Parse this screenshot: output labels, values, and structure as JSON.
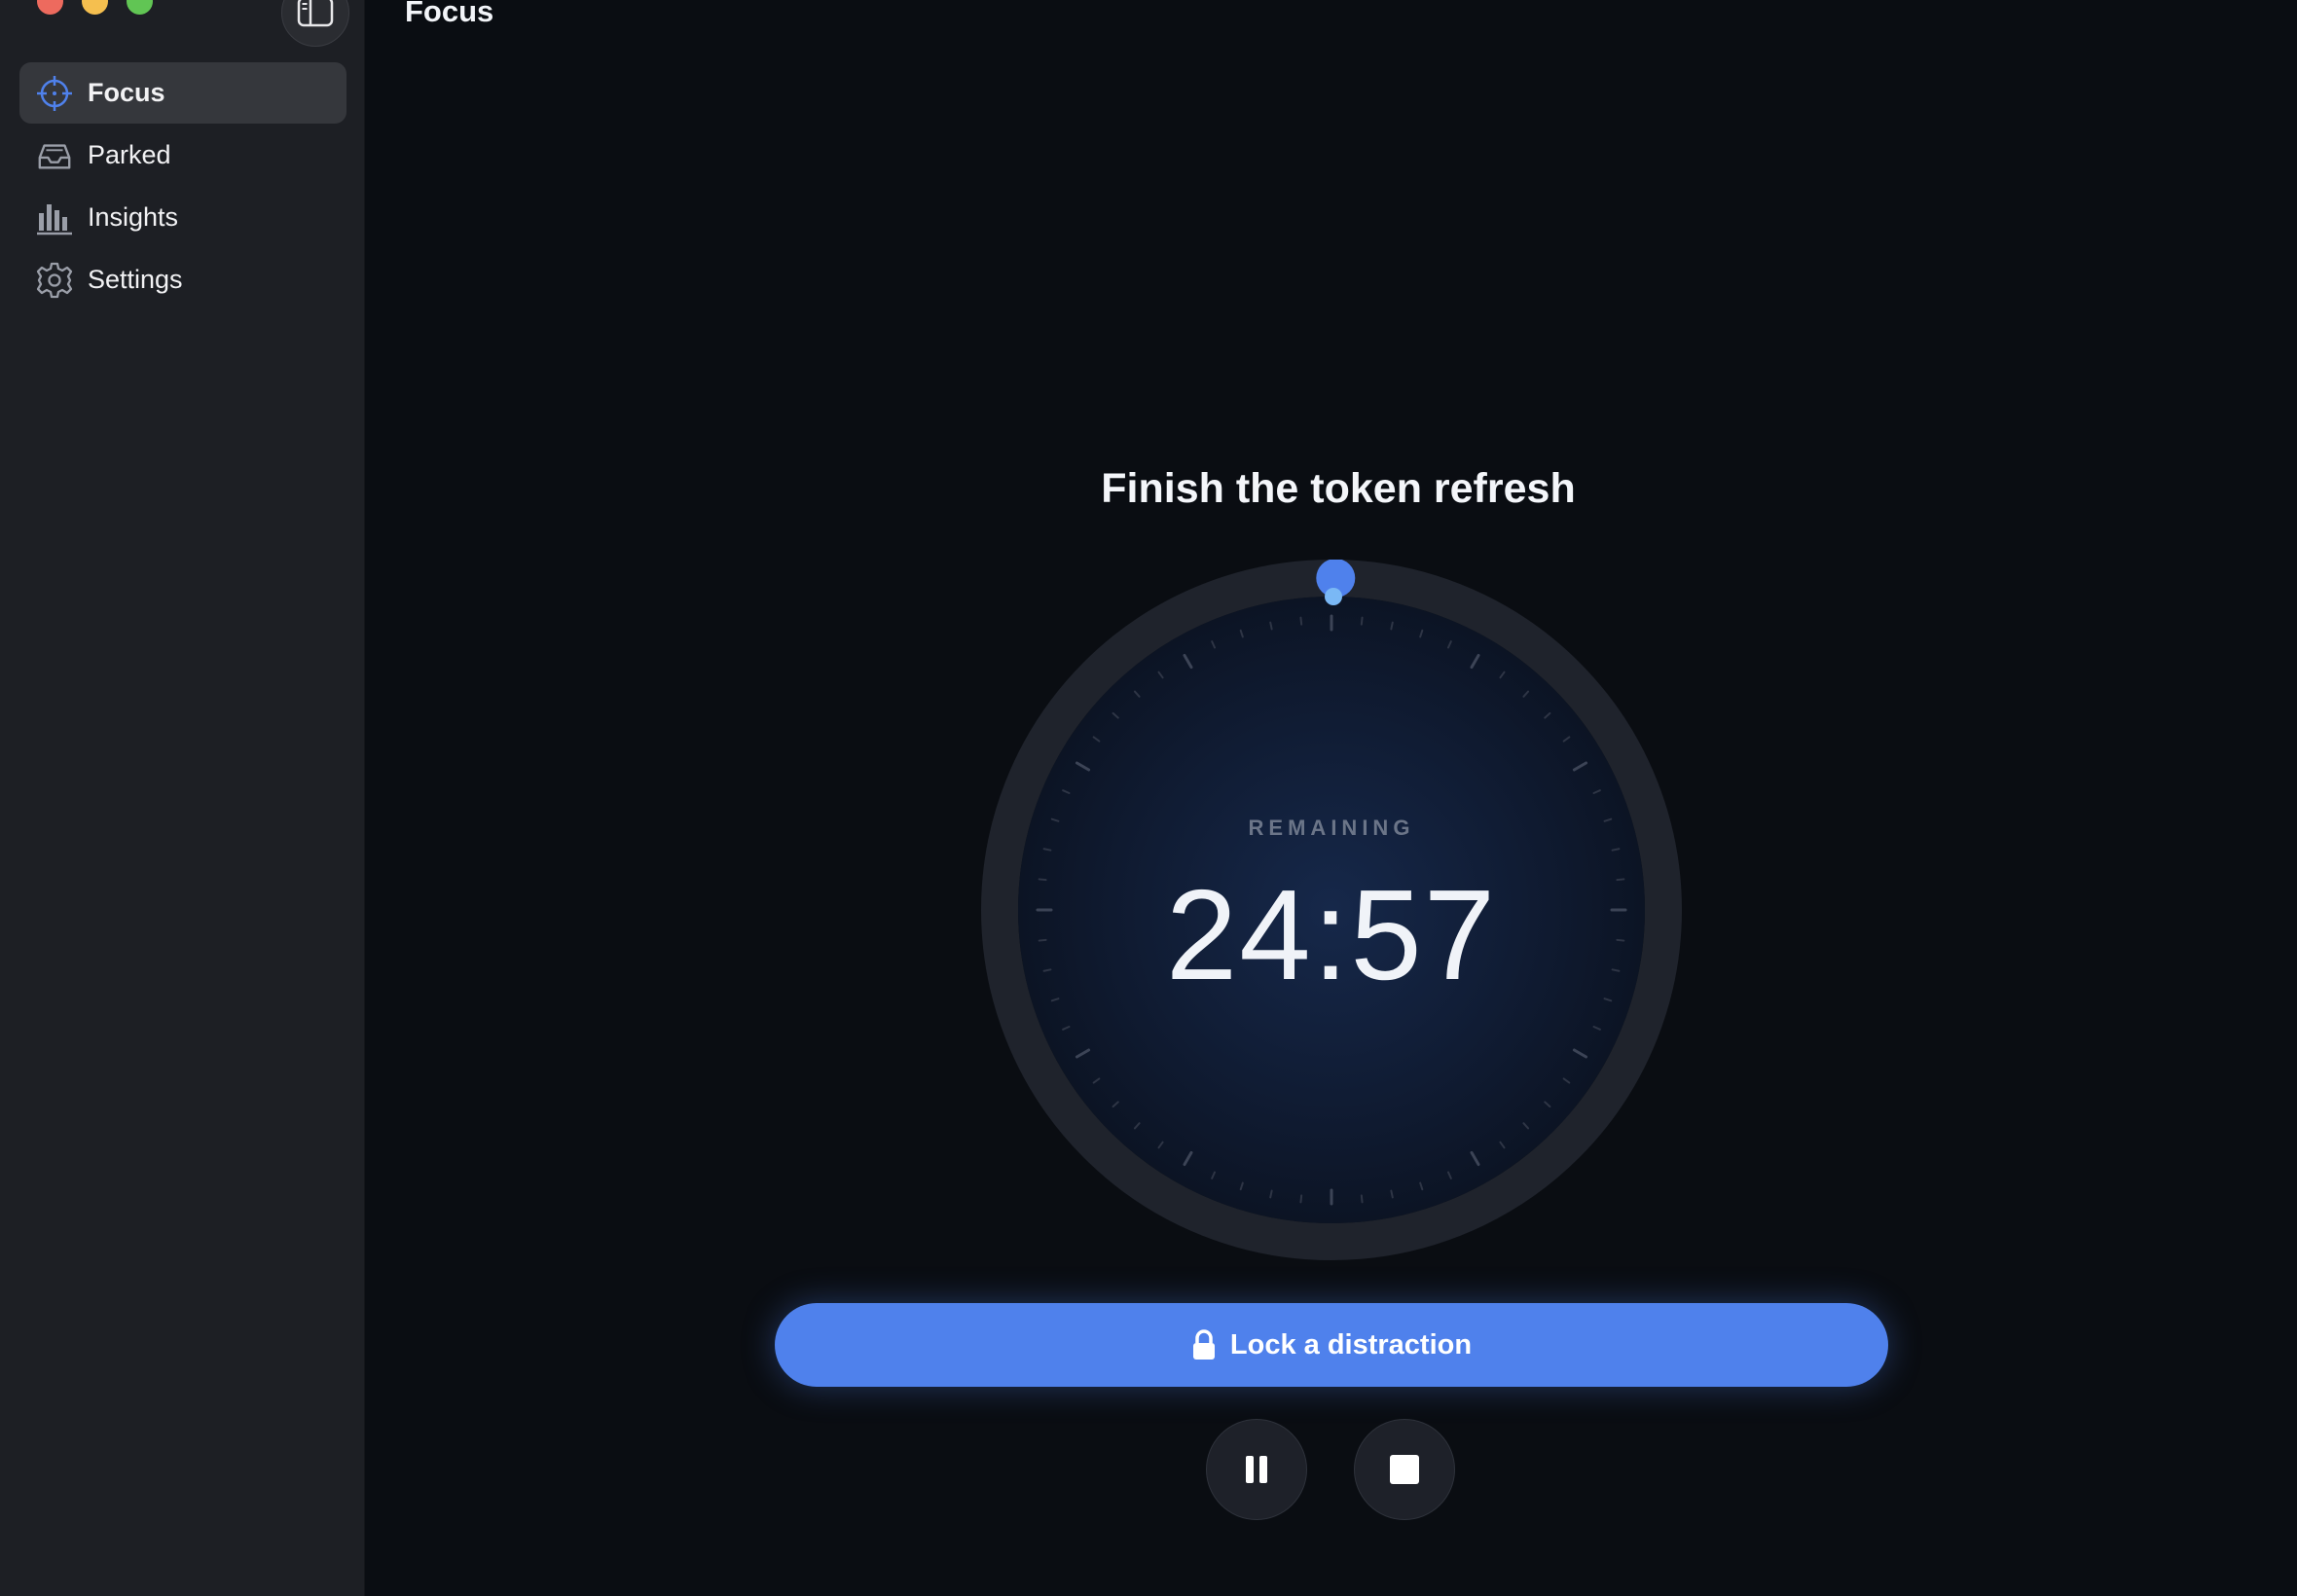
{
  "window": {
    "title": "Focus"
  },
  "sidebar": {
    "items": [
      {
        "label": "Focus",
        "icon": "crosshair-icon",
        "active": true
      },
      {
        "label": "Parked",
        "icon": "tray-icon",
        "active": false
      },
      {
        "label": "Insights",
        "icon": "bar-chart-icon",
        "active": false
      },
      {
        "label": "Settings",
        "icon": "gear-icon",
        "active": false
      }
    ]
  },
  "session": {
    "task": "Finish the token refresh",
    "remaining_label": "REMAINING",
    "time": "24:57",
    "progress_fraction": 0.002
  },
  "actions": {
    "lock_label": "Lock a distraction"
  },
  "colors": {
    "accent": "#4f81ec",
    "sidebar_bg": "#1d1f24",
    "main_bg": "#0a0d12"
  }
}
